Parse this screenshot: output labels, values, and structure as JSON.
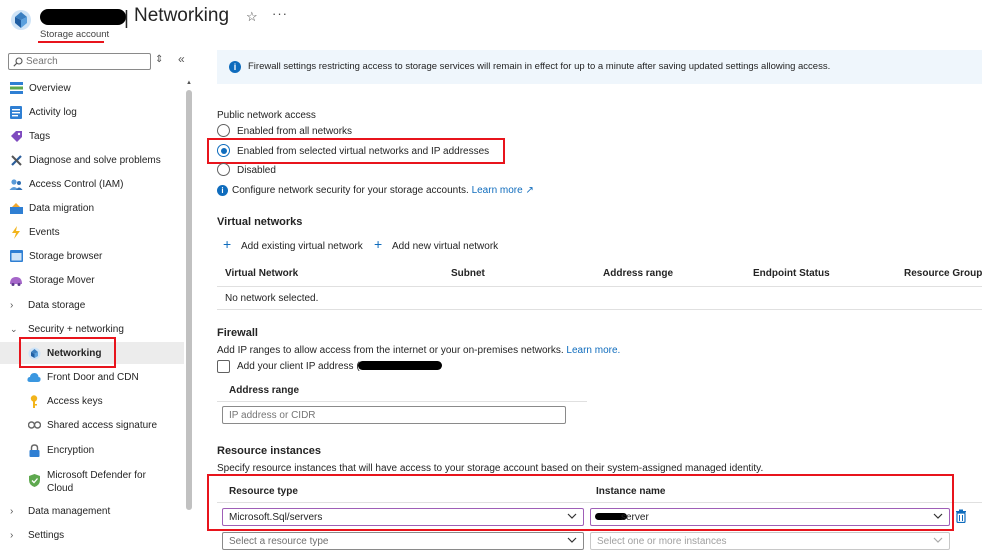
{
  "header": {
    "title": "Networking",
    "subtitle": "Storage account",
    "star_icon": "star-icon",
    "more_icon": "more-icon"
  },
  "sidebar": {
    "search_placeholder": "Search",
    "items": [
      {
        "label": "Overview",
        "icon": "overview-icon"
      },
      {
        "label": "Activity log",
        "icon": "activity-log-icon"
      },
      {
        "label": "Tags",
        "icon": "tag-icon"
      },
      {
        "label": "Diagnose and solve problems",
        "icon": "wrench-icon"
      },
      {
        "label": "Access Control (IAM)",
        "icon": "people-icon"
      },
      {
        "label": "Data migration",
        "icon": "data-migration-icon"
      },
      {
        "label": "Events",
        "icon": "lightning-icon"
      },
      {
        "label": "Storage browser",
        "icon": "storage-browser-icon"
      },
      {
        "label": "Storage Mover",
        "icon": "storage-mover-icon"
      },
      {
        "label": "Data storage",
        "icon": "chevron-right-icon"
      },
      {
        "label": "Security + networking",
        "icon": "chevron-down-icon"
      },
      {
        "label": "Networking",
        "icon": "networking-icon"
      },
      {
        "label": "Front Door and CDN",
        "icon": "cloud-icon"
      },
      {
        "label": "Access keys",
        "icon": "key-icon"
      },
      {
        "label": "Shared access signature",
        "icon": "link-icon"
      },
      {
        "label": "Encryption",
        "icon": "lock-icon"
      },
      {
        "label": "Microsoft Defender for Cloud",
        "icon": "shield-icon"
      },
      {
        "label": "Data management",
        "icon": "chevron-right-icon"
      },
      {
        "label": "Settings",
        "icon": "chevron-right-icon"
      }
    ]
  },
  "banner": {
    "text": "Firewall settings restricting access to storage services will remain in effect for up to a minute after saving updated settings allowing access."
  },
  "public_access": {
    "label": "Public network access",
    "options": [
      "Enabled from all networks",
      "Enabled from selected virtual networks and IP addresses",
      "Disabled"
    ],
    "selected": 1,
    "info_text": "Configure network security for your storage accounts.",
    "learn_more": "Learn more"
  },
  "virtual_networks": {
    "title": "Virtual networks",
    "add_existing": "Add existing virtual network",
    "add_new": "Add new virtual network",
    "columns": [
      "Virtual Network",
      "Subnet",
      "Address range",
      "Endpoint Status",
      "Resource Group"
    ],
    "empty_text": "No network selected."
  },
  "firewall": {
    "title": "Firewall",
    "description": "Add IP ranges to allow access from the internet or your on-premises networks.",
    "learn_more": "Learn more.",
    "client_ip_label": "Add your client IP address ('",
    "address_range_header": "Address range",
    "address_placeholder": "IP address or CIDR"
  },
  "resource_instances": {
    "title": "Resource instances",
    "description": "Specify resource instances that will have access to your storage account based on their system-assigned managed identity.",
    "col_resource_type": "Resource type",
    "col_instance_name": "Instance name",
    "row1_type": "Microsoft.Sql/servers",
    "row1_instance": "server",
    "row2_type_placeholder": "Select a resource type",
    "row2_instance_placeholder": "Select one or more instances"
  },
  "colors": {
    "accent": "#0f6cbd",
    "highlight": "#e8141c",
    "banner_bg": "#eff6fc",
    "selected_bg": "#ececec"
  }
}
